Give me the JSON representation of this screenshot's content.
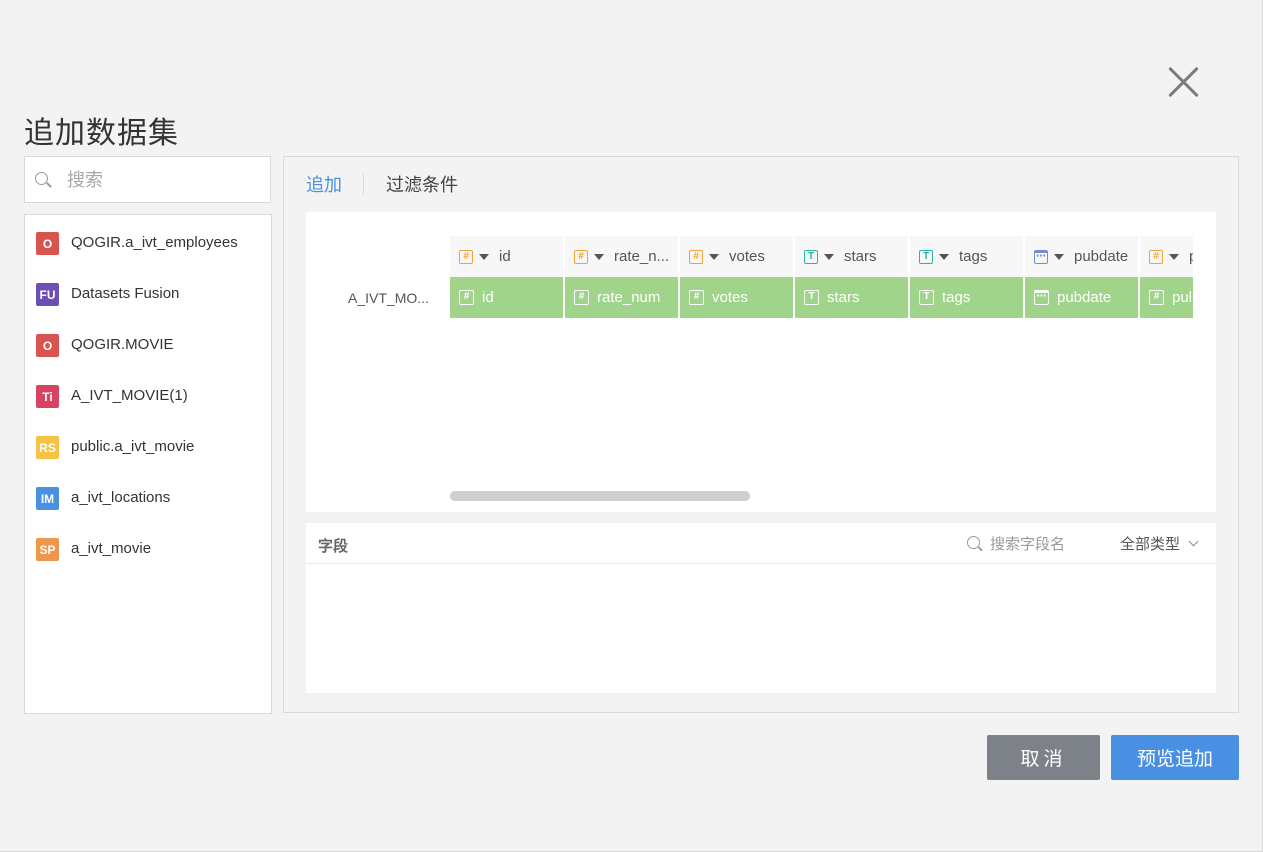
{
  "dialog": {
    "title": "追加数据集",
    "close_icon": "close-icon"
  },
  "search": {
    "placeholder": "搜索"
  },
  "datasets": [
    {
      "badge": "O",
      "color": "#d9534f",
      "label": "QOGIR.a_ivt_employees"
    },
    {
      "badge": "FU",
      "color": "#6b4fb5",
      "label": "Datasets Fusion"
    },
    {
      "badge": "O",
      "color": "#d9534f",
      "label": "QOGIR.MOVIE"
    },
    {
      "badge": "Ti",
      "color": "#d64464",
      "label": "A_IVT_MOVIE(1)"
    },
    {
      "badge": "RS",
      "color": "#f5c242",
      "label": "public.a_ivt_movie"
    },
    {
      "badge": "IM",
      "color": "#4a90e2",
      "label": "a_ivt_locations"
    },
    {
      "badge": "SP",
      "color": "#f0964a",
      "label": "a_ivt_movie"
    }
  ],
  "tabs": [
    {
      "label": "追加",
      "active": true
    },
    {
      "label": "过滤条件",
      "active": false
    }
  ],
  "mapping": {
    "row_label": "A_IVT_MO...",
    "columns": [
      {
        "type": "number",
        "head": "id",
        "cell": "id"
      },
      {
        "type": "number",
        "head": "rate_n...",
        "cell": "rate_num"
      },
      {
        "type": "number",
        "head": "votes",
        "cell": "votes"
      },
      {
        "type": "text",
        "head": "stars",
        "cell": "stars"
      },
      {
        "type": "text",
        "head": "tags",
        "cell": "tags"
      },
      {
        "type": "date",
        "head": "pubdate",
        "cell": "pubdate"
      },
      {
        "type": "number",
        "head": "p",
        "cell": "pul"
      }
    ],
    "accent_color": "#9fd48a"
  },
  "fields": {
    "title": "字段",
    "search_placeholder": "搜索字段名",
    "type_filter": "全部类型"
  },
  "buttons": {
    "cancel": "取消",
    "ok": "预览追加"
  },
  "colors": {
    "primary": "#4a90e2",
    "cancel": "#7d8289"
  }
}
